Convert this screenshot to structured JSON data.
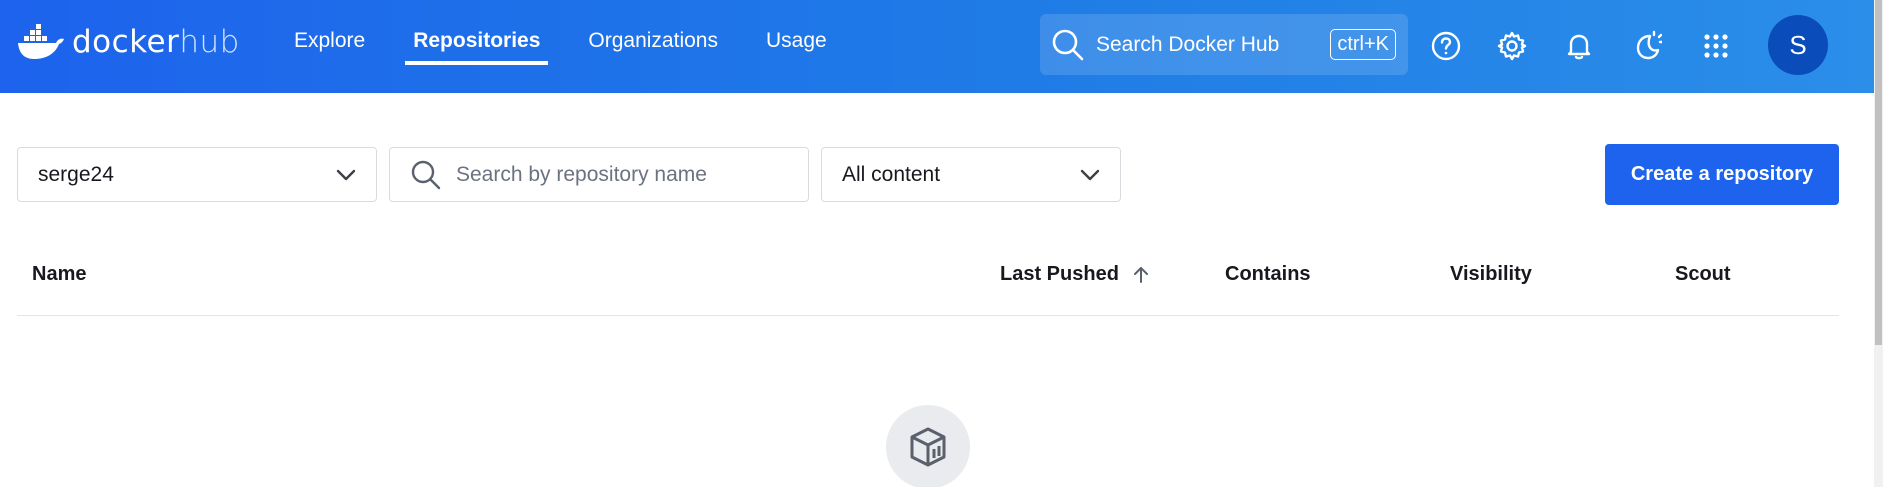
{
  "brand": {
    "name_docker": "docker",
    "name_hub": "hub"
  },
  "nav": [
    {
      "label": "Explore",
      "active": false
    },
    {
      "label": "Repositories",
      "active": true
    },
    {
      "label": "Organizations",
      "active": false
    },
    {
      "label": "Usage",
      "active": false
    }
  ],
  "header_search": {
    "placeholder": "Search Docker Hub",
    "shortcut": "ctrl+K"
  },
  "header_icons": [
    "help-icon",
    "gear-icon",
    "bell-icon",
    "theme-toggle-icon",
    "apps-grid-icon"
  ],
  "user": {
    "avatar_initial": "S"
  },
  "filters": {
    "namespace": "serge24",
    "repo_search_placeholder": "Search by repository name",
    "content": "All content"
  },
  "create_button": "Create a repository",
  "table": {
    "columns": [
      "Name",
      "Last Pushed",
      "Contains",
      "Visibility",
      "Scout"
    ]
  },
  "colors": {
    "brand_blue": "#1d63ed",
    "header_gradient_end": "#2b8ee9"
  }
}
